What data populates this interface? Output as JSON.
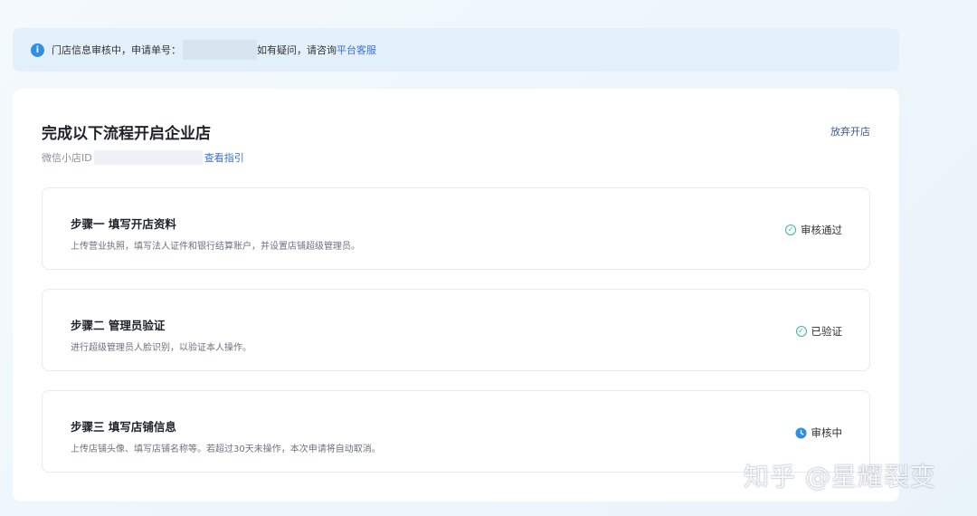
{
  "notice": {
    "text_before": "门店信息审核中，申请单号：",
    "text_after": "如有疑问，请咨询",
    "link": "平台客服"
  },
  "header": {
    "title": "完成以下流程开启企业店",
    "abandon": "放弃开店",
    "shop_id_label": "微信小店ID",
    "guide_link": "查看指引"
  },
  "steps": [
    {
      "title": "步骤一 填写开店资料",
      "desc": "上传营业执照，填写法人证件和银行结算账户，并设置店铺超级管理员。",
      "status": "审核通过",
      "status_icon": "check-circle-icon"
    },
    {
      "title": "步骤二 管理员验证",
      "desc": "进行超级管理员人脸识别，以验证本人操作。",
      "status": "已验证",
      "status_icon": "check-circle-icon"
    },
    {
      "title": "步骤三 填写店铺信息",
      "desc": "上传店铺头像、填写店铺名称等。若超过30天未操作，本次申请将自动取消。",
      "status": "审核中",
      "status_icon": "clock-icon"
    }
  ],
  "watermark": "知乎 @星耀裂变",
  "colors": {
    "accent": "#3a6fd8",
    "success": "#3ab896",
    "pending": "#2f8fe0"
  }
}
